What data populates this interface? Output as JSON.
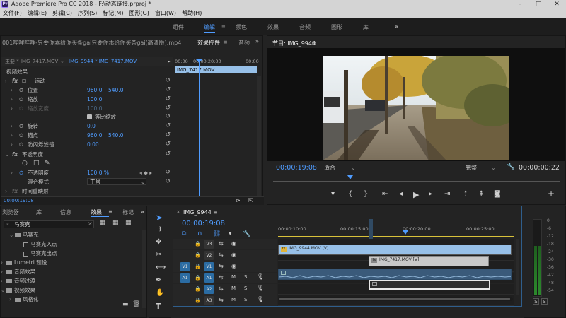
{
  "window": {
    "title": "Adobe Premiere Pro CC 2018 - F:\\动态链接.prproj *",
    "app_icon": "Pr",
    "controls": [
      "minimize-icon",
      "maximize-icon",
      "close-icon"
    ]
  },
  "menubar": [
    "文件(F)",
    "编辑(E)",
    "剪辑(C)",
    "序列(S)",
    "标记(M)",
    "图形(G)",
    "窗口(W)",
    "帮助(H)"
  ],
  "workspaces": {
    "items": [
      "组件",
      "编辑",
      "颜色",
      "效果",
      "音频",
      "图形",
      "库"
    ],
    "active": "编辑",
    "more": "»"
  },
  "source_panel": {
    "tab_label": "001哔哩哔哩-只要你乖给你买条gai只要你乖给你买条gai(高清版).mp4",
    "effect_controls_tab": "效果控件",
    "extra_tab": "音频",
    "menu_glyph": "≡",
    "more_glyph": "»",
    "master_label": "主要 * IMG_7417.MOV",
    "clip_label": "IMG_9944 * IMG_7417.MOV",
    "ruler_start": "00:00",
    "ruler_mid": "00:00:20:00",
    "ruler_end": "00:00",
    "clip_strip": "IMG_7417.MOV",
    "section_video_effects": "视频效果",
    "motion": "运动",
    "properties": [
      {
        "label": "位置",
        "v1": "960.0",
        "v2": "540.0",
        "toggle": true
      },
      {
        "label": "缩放",
        "v1": "100.0",
        "v2": "",
        "toggle": true
      },
      {
        "label": "缩放宽度",
        "v1": "100.0",
        "v2": "",
        "toggle": false,
        "disabled": true
      }
    ],
    "uniform_scale": "等比缩放",
    "more_props": [
      {
        "label": "旋转",
        "v1": "0.0",
        "v2": ""
      },
      {
        "label": "锚点",
        "v1": "960.0",
        "v2": "540.0"
      },
      {
        "label": "防闪烁滤镜",
        "v1": "0.00",
        "v2": ""
      }
    ],
    "opacity_section": "不透明度",
    "opacity_label": "不透明度",
    "opacity_value": "100.0 %",
    "blend_label": "混合模式",
    "blend_value": "正常",
    "time_remap": "时间重映射",
    "timecode": "00:00:19:08"
  },
  "program_monitor": {
    "title": "节目: IMG_9944",
    "menu_glyph": "≡",
    "timecode": "00:00:19:08",
    "fit": "适合",
    "quality": "完整",
    "duration": "00:00:00:22",
    "scene": {
      "sky": "#e6eef2",
      "ground": "#8c7f6c",
      "trees": "#b8952b",
      "shadow": "#3c352b"
    }
  },
  "project_panel": {
    "tabs": [
      "浏览器",
      "库",
      "信息",
      "效果",
      "标记"
    ],
    "active_tab": "效果",
    "menu_glyph": "≡",
    "more_glyph": "»",
    "search_value": "马赛克",
    "tree": [
      {
        "label": "马赛克",
        "depth": 1,
        "type": "folder"
      },
      {
        "label": "马赛克入点",
        "depth": 2,
        "type": "preset"
      },
      {
        "label": "马赛克出点",
        "depth": 2,
        "type": "preset"
      },
      {
        "label": "Lumetri 预设",
        "depth": 0,
        "type": "folder"
      },
      {
        "label": "音频效果",
        "depth": 0,
        "type": "folder"
      },
      {
        "label": "音频过渡",
        "depth": 0,
        "type": "folder"
      },
      {
        "label": "视频效果",
        "depth": 0,
        "type": "folder"
      },
      {
        "label": "风格化",
        "depth": 1,
        "type": "folder"
      }
    ]
  },
  "tools": [
    "selection-tool",
    "track-select-tool",
    "ripple-edit-tool",
    "razor-tool",
    "slip-tool",
    "pen-tool",
    "hand-tool",
    "type-tool"
  ],
  "timeline": {
    "sequence_name": "IMG_9944",
    "menu_glyph": "≡",
    "timecode": "00:00:19:08",
    "ruler_labels": [
      "00:00:10:00",
      "00:00:15:00",
      "00:00:20:00",
      "00:00:25:00"
    ],
    "tracks": [
      {
        "label": "V3",
        "source": "",
        "type": "video"
      },
      {
        "label": "V2",
        "source": "",
        "type": "video"
      },
      {
        "label": "V1",
        "source": "V1",
        "type": "video"
      },
      {
        "label": "A1",
        "source": "A1",
        "type": "audio"
      },
      {
        "label": "A2",
        "source": "",
        "type": "audio"
      },
      {
        "label": "A3",
        "source": "",
        "type": "audio"
      }
    ],
    "clips": [
      {
        "name": "IMG_9944.MOV [V]",
        "track": "V2"
      },
      {
        "name": "IMG_7417.MOV [V]",
        "track": "V1"
      }
    ],
    "solo_label": "S",
    "mute_label": "M"
  },
  "audio_meter": {
    "labels": [
      "0",
      "-6",
      "-12",
      "-18",
      "-24",
      "-30",
      "-36",
      "-42",
      "-48",
      "-54"
    ],
    "solo_left": "S",
    "solo_right": "S"
  },
  "colors": {
    "accent": "#4f9cff",
    "panel_bg": "#232323",
    "clip_video": "#97c0e8",
    "clip_audio": "#3a5a7a",
    "track_target": "#2b6ca3"
  }
}
